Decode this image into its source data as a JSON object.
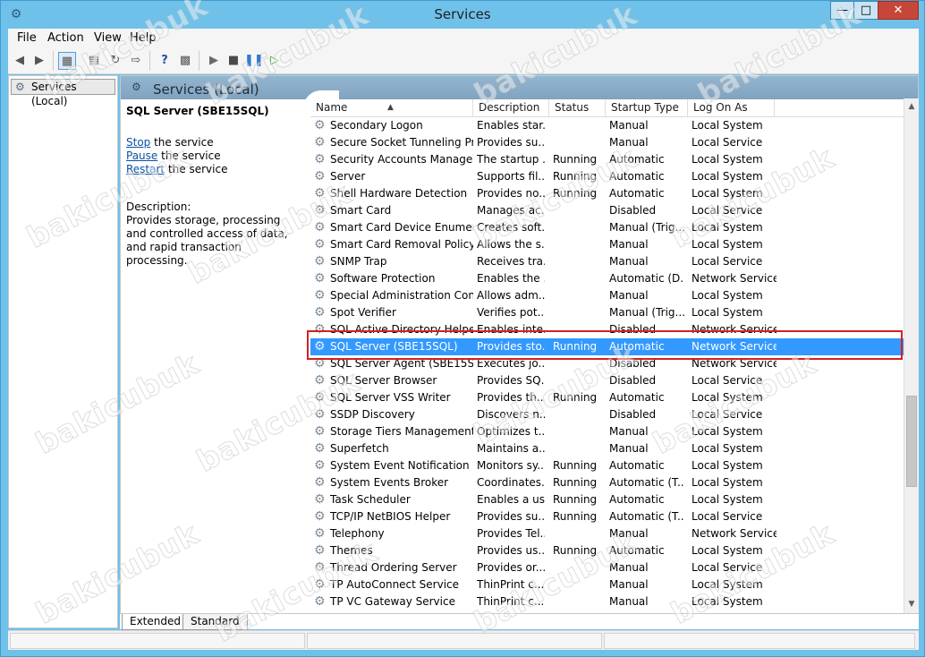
{
  "window": {
    "title": "Services",
    "controls": {
      "minimize": "—",
      "maximize": "□",
      "close": "✕"
    }
  },
  "menubar": [
    "File",
    "Action",
    "View",
    "Help"
  ],
  "toolbar": {
    "icons": [
      "back-icon",
      "forward-icon",
      "console-tree-icon",
      "properties-icon",
      "refresh-icon",
      "export-icon",
      "help-icon",
      "show-hide-icon",
      "start-service-icon",
      "stop-service-icon",
      "pause-service-icon",
      "resume-service-icon"
    ]
  },
  "tree": {
    "item_label": "Services (Local)"
  },
  "main": {
    "header_title": "Services (Local)",
    "selected_service_name": "SQL Server (SBE15SQL)",
    "actions": [
      {
        "link": "Stop",
        "rest": " the service"
      },
      {
        "link": "Pause",
        "rest": " the service"
      },
      {
        "link": "Restart",
        "rest": " the service"
      }
    ],
    "description_label": "Description:",
    "description_text": "Provides storage, processing and controlled access of data, and rapid transaction processing."
  },
  "table": {
    "columns": [
      "Name",
      "Description",
      "Status",
      "Startup Type",
      "Log On As"
    ],
    "rows": [
      {
        "name": "Secondary Logon",
        "desc": "Enables star...",
        "status": "",
        "startup": "Manual",
        "logon": "Local System"
      },
      {
        "name": "Secure Socket Tunneling Pr...",
        "desc": "Provides su...",
        "status": "",
        "startup": "Manual",
        "logon": "Local Service"
      },
      {
        "name": "Security Accounts Manager",
        "desc": "The startup ...",
        "status": "Running",
        "startup": "Automatic",
        "logon": "Local System"
      },
      {
        "name": "Server",
        "desc": "Supports fil...",
        "status": "Running",
        "startup": "Automatic",
        "logon": "Local System"
      },
      {
        "name": "Shell Hardware Detection",
        "desc": "Provides no...",
        "status": "Running",
        "startup": "Automatic",
        "logon": "Local System"
      },
      {
        "name": "Smart Card",
        "desc": "Manages ac...",
        "status": "",
        "startup": "Disabled",
        "logon": "Local Service"
      },
      {
        "name": "Smart Card Device Enumera...",
        "desc": "Creates soft...",
        "status": "",
        "startup": "Manual (Trig...",
        "logon": "Local System"
      },
      {
        "name": "Smart Card Removal Policy",
        "desc": "Allows the s...",
        "status": "",
        "startup": "Manual",
        "logon": "Local System"
      },
      {
        "name": "SNMP Trap",
        "desc": "Receives tra...",
        "status": "",
        "startup": "Manual",
        "logon": "Local Service"
      },
      {
        "name": "Software Protection",
        "desc": "Enables the ...",
        "status": "",
        "startup": "Automatic (D...",
        "logon": "Network Service"
      },
      {
        "name": "Special Administration Con...",
        "desc": "Allows adm...",
        "status": "",
        "startup": "Manual",
        "logon": "Local System"
      },
      {
        "name": "Spot Verifier",
        "desc": "Verifies pot...",
        "status": "",
        "startup": "Manual (Trig...",
        "logon": "Local System"
      },
      {
        "name": "SQL Active Directory Helper...",
        "desc": "Enables inte...",
        "status": "",
        "startup": "Disabled",
        "logon": "Network Service"
      },
      {
        "name": "SQL Server (SBE15SQL)",
        "desc": "Provides sto...",
        "status": "Running",
        "startup": "Automatic",
        "logon": "Network Service",
        "selected": true
      },
      {
        "name": "SQL Server Agent (SBE15SQL)",
        "desc": "Executes jo...",
        "status": "",
        "startup": "Disabled",
        "logon": "Network Service"
      },
      {
        "name": "SQL Server Browser",
        "desc": "Provides SQ...",
        "status": "",
        "startup": "Disabled",
        "logon": "Local Service"
      },
      {
        "name": "SQL Server VSS Writer",
        "desc": "Provides th...",
        "status": "Running",
        "startup": "Automatic",
        "logon": "Local System"
      },
      {
        "name": "SSDP Discovery",
        "desc": "Discovers n...",
        "status": "",
        "startup": "Disabled",
        "logon": "Local Service"
      },
      {
        "name": "Storage Tiers Management",
        "desc": "Optimizes t...",
        "status": "",
        "startup": "Manual",
        "logon": "Local System"
      },
      {
        "name": "Superfetch",
        "desc": "Maintains a...",
        "status": "",
        "startup": "Manual",
        "logon": "Local System"
      },
      {
        "name": "System Event Notification S...",
        "desc": "Monitors sy...",
        "status": "Running",
        "startup": "Automatic",
        "logon": "Local System"
      },
      {
        "name": "System Events Broker",
        "desc": "Coordinates...",
        "status": "Running",
        "startup": "Automatic (T...",
        "logon": "Local System"
      },
      {
        "name": "Task Scheduler",
        "desc": "Enables a us...",
        "status": "Running",
        "startup": "Automatic",
        "logon": "Local System"
      },
      {
        "name": "TCP/IP NetBIOS Helper",
        "desc": "Provides su...",
        "status": "Running",
        "startup": "Automatic (T...",
        "logon": "Local Service"
      },
      {
        "name": "Telephony",
        "desc": "Provides Tel...",
        "status": "",
        "startup": "Manual",
        "logon": "Network Service"
      },
      {
        "name": "Themes",
        "desc": "Provides us...",
        "status": "Running",
        "startup": "Automatic",
        "logon": "Local System"
      },
      {
        "name": "Thread Ordering Server",
        "desc": "Provides or...",
        "status": "",
        "startup": "Manual",
        "logon": "Local Service"
      },
      {
        "name": "TP AutoConnect Service",
        "desc": "ThinPrint c...",
        "status": "",
        "startup": "Manual",
        "logon": "Local System"
      },
      {
        "name": "TP VC Gateway Service",
        "desc": "ThinPrint c...",
        "status": "",
        "startup": "Manual",
        "logon": "Local System"
      }
    ]
  },
  "tabs": [
    "Extended",
    "Standard"
  ],
  "watermark": "bakicubuk",
  "colors": {
    "selection": "#3399ff",
    "highlight_box": "#d62020",
    "link": "#0b52a3"
  }
}
